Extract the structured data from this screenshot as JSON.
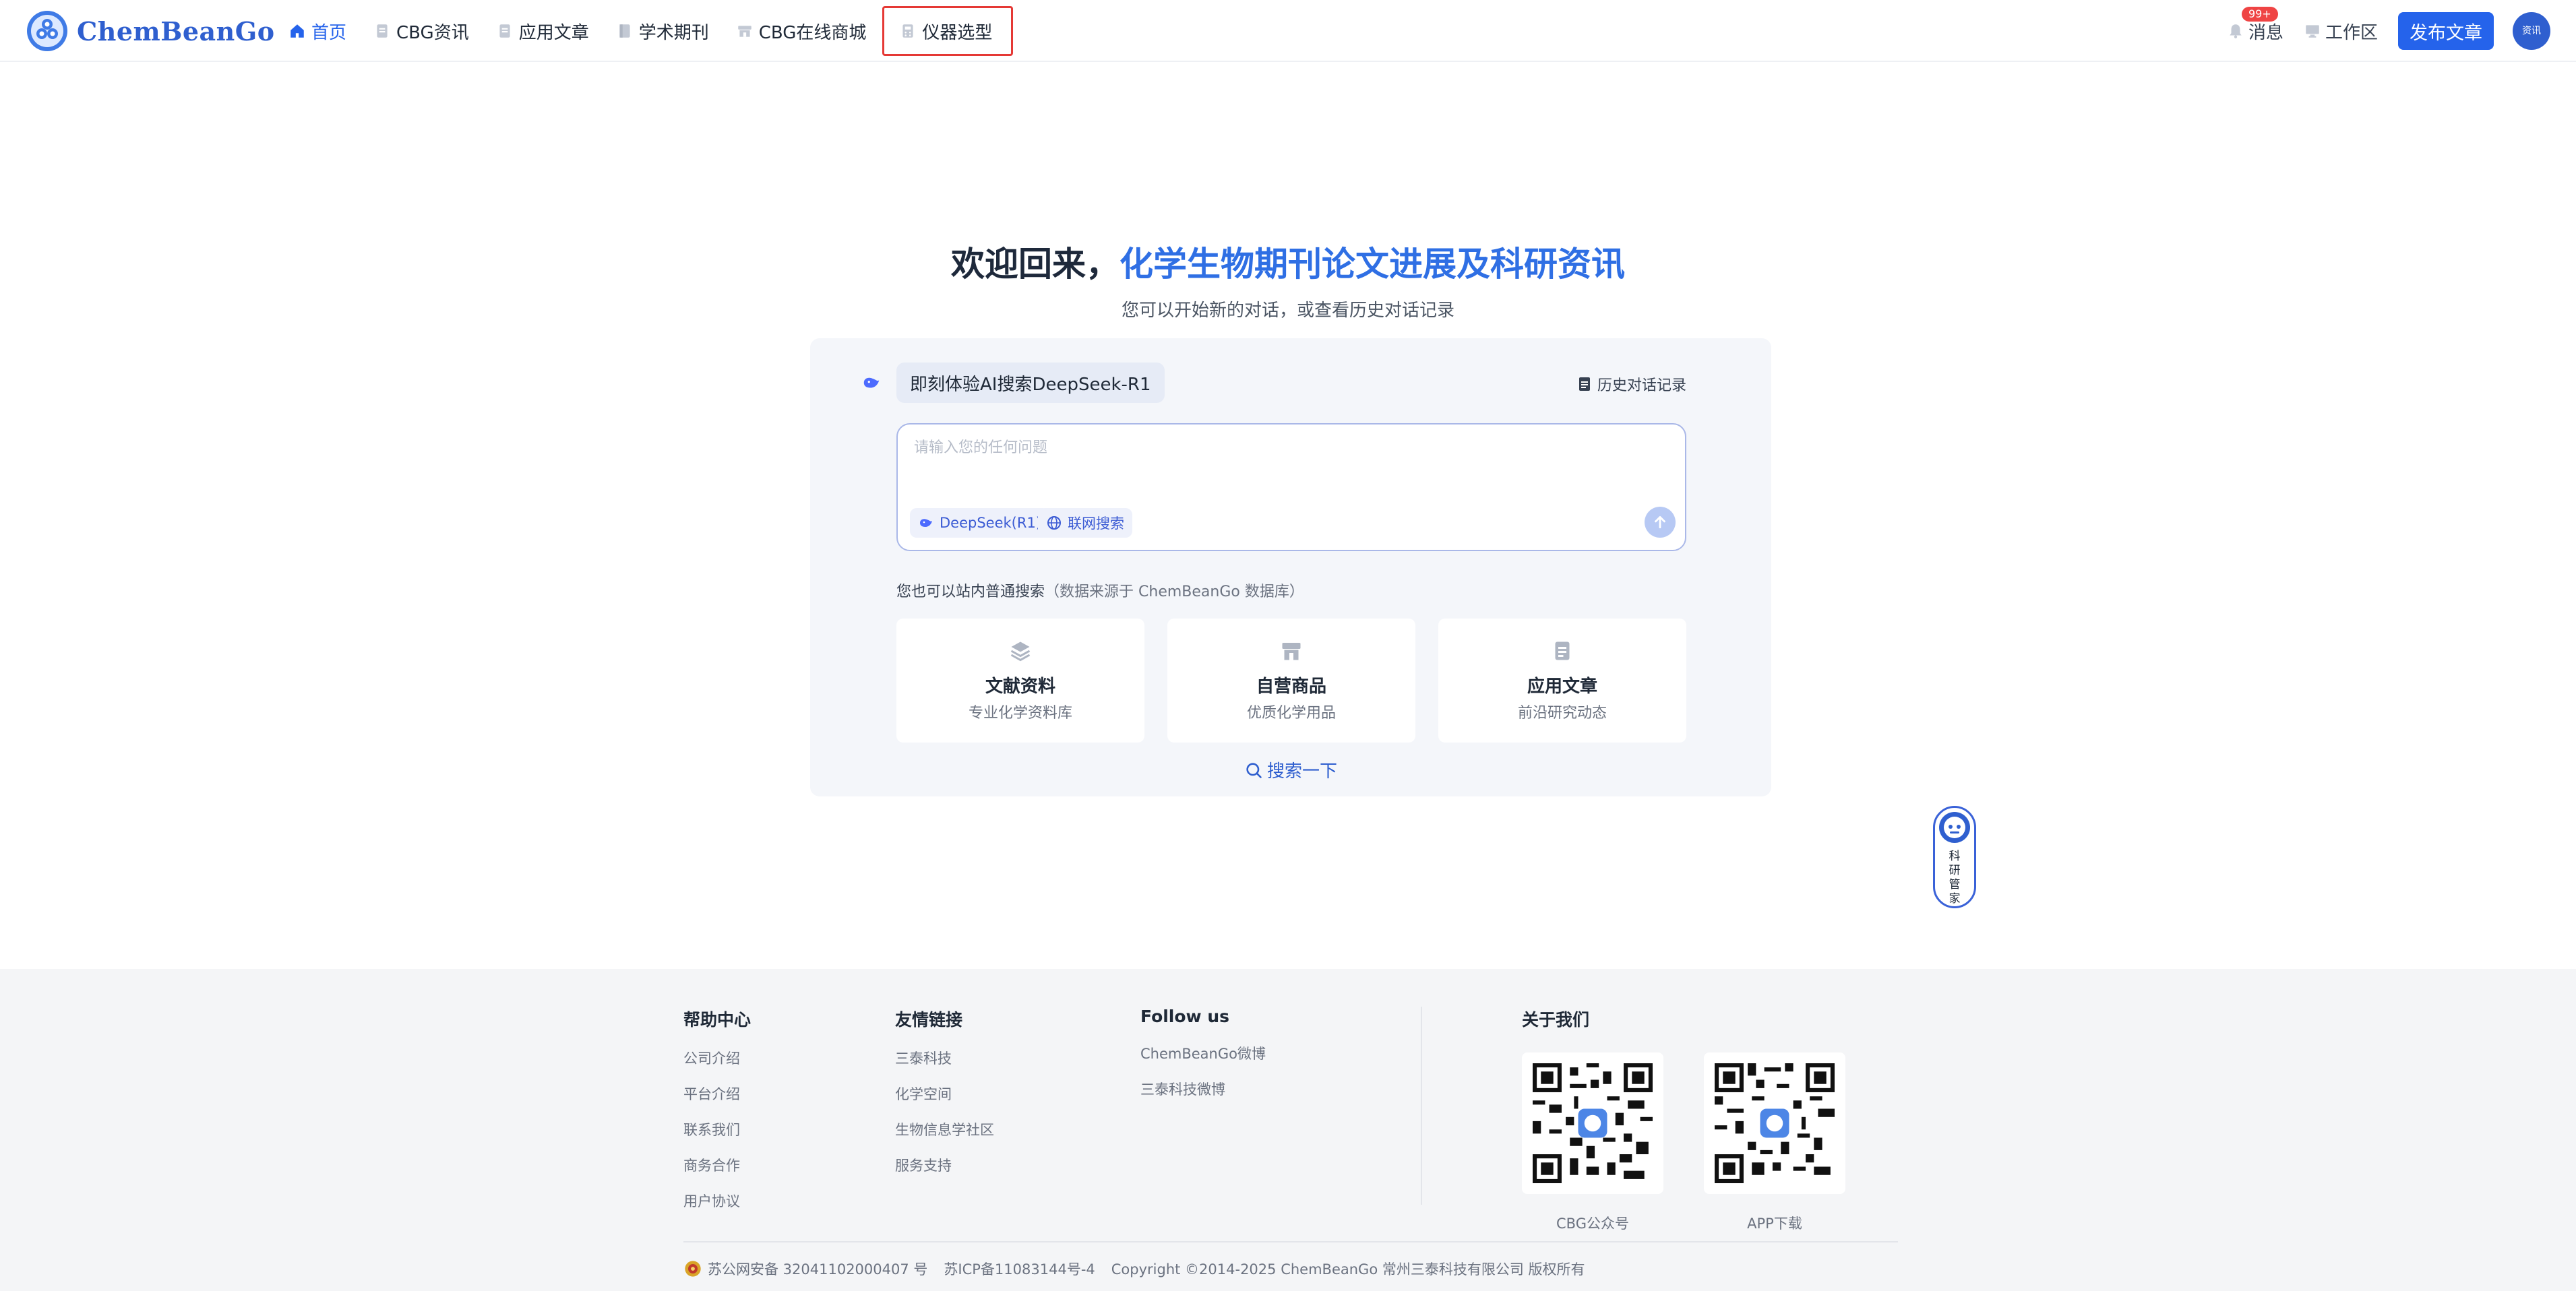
{
  "header": {
    "logo_text": "ChemBeanGo",
    "nav": [
      {
        "label": "首页"
      },
      {
        "label": "CBG资讯"
      },
      {
        "label": "应用文章"
      },
      {
        "label": "学术期刊"
      },
      {
        "label": "CBG在线商城"
      },
      {
        "label": "仪器选型"
      }
    ],
    "messages_label": "消息",
    "messages_badge": "99+",
    "workspace_label": "工作区",
    "publish_label": "发布文章",
    "avatar_text": "资讯"
  },
  "hero": {
    "title_prefix": "欢迎回来，",
    "title_highlight": "化学生物期刊论文进展及科研资讯",
    "subtitle": "您可以开始新的对话，或查看历史对话记录"
  },
  "panel": {
    "ai_pill": "即刻体验AI搜索DeepSeek-R1",
    "history_label": "历史对话记录",
    "input_placeholder": "请输入您的任何问题",
    "chip_model": "DeepSeek(R1)",
    "chip_web": "联网搜索",
    "hint_main": "您也可以站内普通搜索",
    "hint_muted": "（数据来源于 ChemBeanGo 数据库）",
    "cards": [
      {
        "title": "文献资料",
        "subtitle": "专业化学资料库",
        "icon": "layers-icon"
      },
      {
        "title": "自营商品",
        "subtitle": "优质化学用品",
        "icon": "store-icon"
      },
      {
        "title": "应用文章",
        "subtitle": "前沿研究动态",
        "icon": "document-icon"
      }
    ],
    "search_label": "搜索一下"
  },
  "assistant": {
    "label": "科研管家"
  },
  "footer": {
    "help": {
      "title": "帮助中心",
      "links": [
        "公司介绍",
        "平台介绍",
        "联系我们",
        "商务合作",
        "用户协议"
      ]
    },
    "friends": {
      "title": "友情链接",
      "links": [
        "三泰科技",
        "化学空间",
        "生物信息学社区",
        "服务支持"
      ]
    },
    "follow": {
      "title": "Follow us",
      "links": [
        "ChemBeanGo微博",
        "三泰科技微博"
      ]
    },
    "about": {
      "title": "关于我们",
      "qr1_label": "CBG公众号",
      "qr2_label": "APP下载"
    },
    "police": "苏公网安备 32041102000407 号",
    "icp": "苏ICP备11083144号-4",
    "copyright": "Copyright ©2014-2025 ChemBeanGo 常州三泰科技有限公司 版权所有"
  },
  "colors": {
    "brand": "#2563eb",
    "highlight_border": "#e53935",
    "badge": "#ef4444"
  }
}
